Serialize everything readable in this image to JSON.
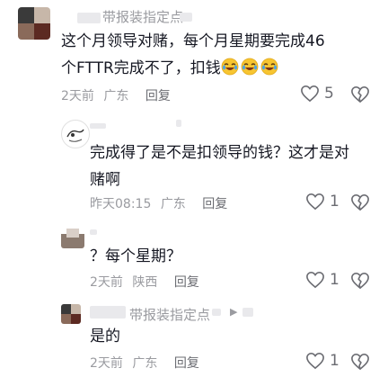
{
  "comments": [
    {
      "username": "带报装指定点",
      "text": "这个月领导对赌，每个月星期要完成46个FTTR完成不了，扣钱",
      "emojis": [
        "laugh-cry-emoji",
        "laugh-cry-emoji",
        "laugh-cry-emoji"
      ],
      "time": "2天前",
      "location": "广东",
      "reply": "回复",
      "likes": "5"
    },
    {
      "username": "",
      "text": "完成得了是不是扣领导的钱？这才是对赌啊",
      "time": "昨天08:15",
      "location": "广东",
      "reply": "回复",
      "likes": "1"
    },
    {
      "username": "",
      "text": "？每个星期？",
      "time": "2天前",
      "location": "陕西",
      "reply": "回复",
      "likes": "1"
    },
    {
      "username": "带报装指定点",
      "text": "是的",
      "time": "2天前",
      "location": "广东",
      "reply": "回复",
      "likes": "1"
    }
  ],
  "colors": {
    "text": "#161823",
    "meta": "#9a9ba0",
    "icon": "#6b6c72"
  }
}
